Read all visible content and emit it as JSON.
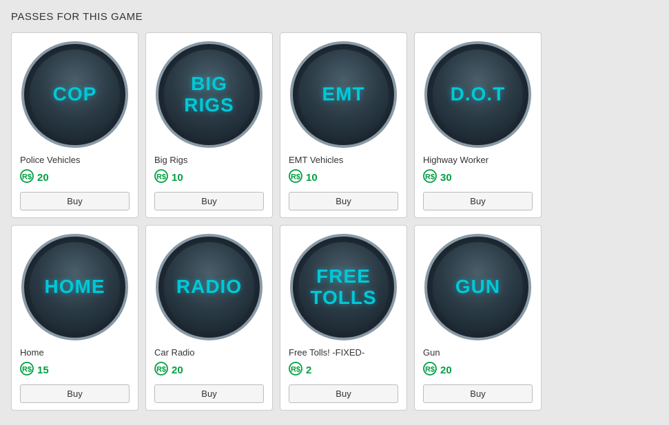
{
  "page": {
    "title": "PASSES FOR THIS GAME"
  },
  "passes": [
    {
      "id": "cop",
      "icon_text": "COP",
      "name": "Police Vehicles",
      "price": 20,
      "buy_label": "Buy"
    },
    {
      "id": "big-rigs",
      "icon_text": "BIG\nRIGS",
      "name": "Big Rigs",
      "price": 10,
      "buy_label": "Buy"
    },
    {
      "id": "emt",
      "icon_text": "EMT",
      "name": "EMT Vehicles",
      "price": 10,
      "buy_label": "Buy"
    },
    {
      "id": "dot",
      "icon_text": "D.O.T",
      "name": "Highway Worker",
      "price": 30,
      "buy_label": "Buy"
    },
    {
      "id": "home",
      "icon_text": "HOME",
      "name": "Home",
      "price": 15,
      "buy_label": "Buy"
    },
    {
      "id": "radio",
      "icon_text": "RADIO",
      "name": "Car Radio",
      "price": 20,
      "buy_label": "Buy"
    },
    {
      "id": "free-tolls",
      "icon_text": "FREE\nTOLLS",
      "name": "Free Tolls! -FIXED-",
      "price": 2,
      "buy_label": "Buy"
    },
    {
      "id": "gun",
      "icon_text": "GUN",
      "name": "Gun",
      "price": 20,
      "buy_label": "Buy"
    }
  ]
}
